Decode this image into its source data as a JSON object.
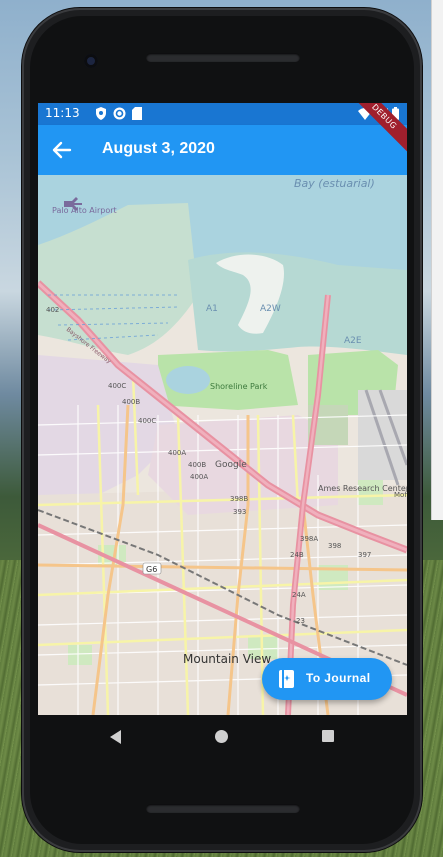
{
  "status_bar": {
    "time": "11:13"
  },
  "app_bar": {
    "title": "August 3, 2020",
    "debug_banner": "DEBUG"
  },
  "map": {
    "labels": {
      "bay": "Bay (estuarial)",
      "airport": "Palo Alto Airport",
      "a1": "A1",
      "a2w": "A2W",
      "a2e": "A2E",
      "park": "Shoreline Park",
      "google": "Google",
      "ames": "Ames Research Center",
      "mountain_view": "Mountain View",
      "moffett": "Moffett Federal Airfield",
      "bayshore": "Bayshore Freeway",
      "r402": "402",
      "r400c": "400C",
      "r400b_1": "400B",
      "r400c_2": "400C",
      "r400a": "400A",
      "r400b_2": "400B",
      "r400a_2": "400A",
      "r398b": "398B",
      "r393": "393",
      "r398a": "398A",
      "r398": "398",
      "r397": "397",
      "r24b": "24B",
      "r24a": "24A",
      "r23": "23",
      "g6": "G6"
    }
  },
  "fab": {
    "label": "To Journal",
    "icon": "journal-icon"
  }
}
